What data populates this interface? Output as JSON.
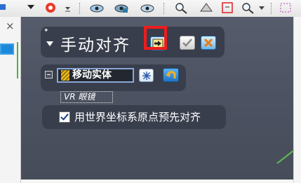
{
  "panel": {
    "title": "手动对齐",
    "apply_icon": "apply-arrow-icon",
    "ok_icon": "checkmark-icon",
    "cancel_icon": "cancel-x-icon"
  },
  "move_entity": {
    "label": "移动实体",
    "reset_icon": "snowflake-icon",
    "undo_icon": "undo-icon"
  },
  "vr_label": "VR 眼镜",
  "option": {
    "label": "用世界坐标系原点预先对齐",
    "checked": true
  },
  "left_pane": {
    "close_symbol": "×"
  },
  "colors": {
    "viewport": "#4d5261",
    "panel": "#393e4c",
    "highlight": "#ee1c1c",
    "accent_blue": "#1f74c4"
  }
}
